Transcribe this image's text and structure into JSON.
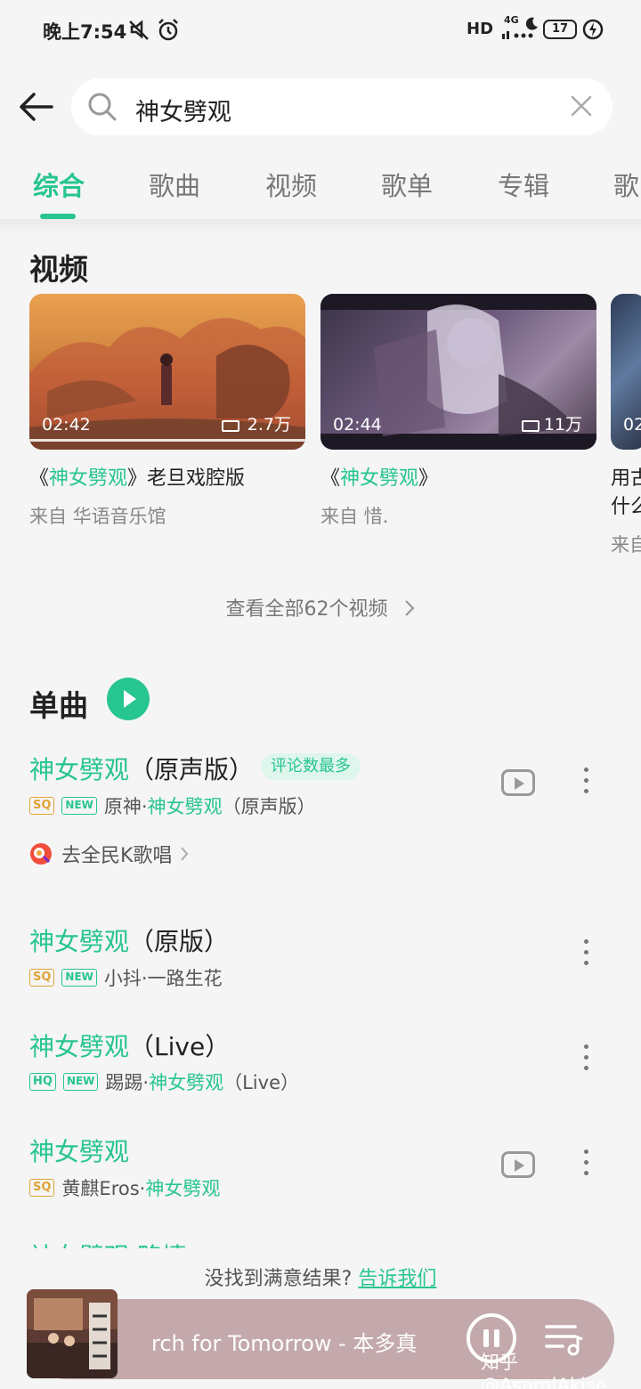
{
  "status_bar": {
    "time": "晚上7:54",
    "battery": "17",
    "network": "4G",
    "hd": "HD"
  },
  "search": {
    "query": "神女劈观"
  },
  "tabs": [
    "综合",
    "歌曲",
    "视频",
    "歌单",
    "专辑",
    "歌"
  ],
  "video_section": {
    "title": "视频",
    "videos": [
      {
        "duration": "02:42",
        "views": "2.7万",
        "title_prefix": "《",
        "title_hl": "神女劈观",
        "title_suffix": "》老旦戏腔版",
        "source": "来自 华语音乐馆"
      },
      {
        "duration": "02:44",
        "views": "11万",
        "title_prefix": "《",
        "title_hl": "神女劈观",
        "title_suffix": "》",
        "source": "来自 惜."
      },
      {
        "duration": "02",
        "title_line1": "用古",
        "title_line2": "什么",
        "source": "来自"
      }
    ],
    "see_all": "查看全部62个视频"
  },
  "songs_section": {
    "title": "单曲",
    "songs": [
      {
        "title_hl": "神女劈观",
        "title_plain": "（原声版）",
        "tag": "评论数最多",
        "quality": "SQ",
        "is_new": true,
        "new_label": "NEW",
        "artist": "原神·",
        "album_hl": "神女劈观",
        "album_plain": "（原声版）",
        "has_mv": true
      },
      {
        "title_hl": "神女劈观",
        "title_plain": "（原版）",
        "quality": "SQ",
        "is_new": true,
        "new_label": "NEW",
        "artist": "小抖·一路生花",
        "has_mv": false
      },
      {
        "title_hl": "神女劈观",
        "title_plain": "（Live）",
        "quality": "HQ",
        "is_new": true,
        "new_label": "NEW",
        "artist": "踢踢·",
        "album_hl": "神女劈观",
        "album_plain": "（Live）",
        "has_mv": false
      },
      {
        "title_hl": "神女劈观",
        "title_plain": "",
        "quality": "SQ",
        "is_new": false,
        "artist": "黄麒Eros·",
        "album_hl": "神女劈观",
        "has_mv": true
      }
    ],
    "karaoke": "去全民K歌唱",
    "partial_next_title": "神女劈观 略情"
  },
  "feedback": {
    "text": "没找到满意结果? ",
    "link": "告诉我们"
  },
  "player": {
    "now_playing": "rch for Tomorrow - 本多真",
    "watermark": "知乎 @AsamiAkise"
  },
  "colors": {
    "accent": "#27c58f",
    "sq_badge": "#e0a436",
    "player_bg": "#c3a9ac"
  }
}
